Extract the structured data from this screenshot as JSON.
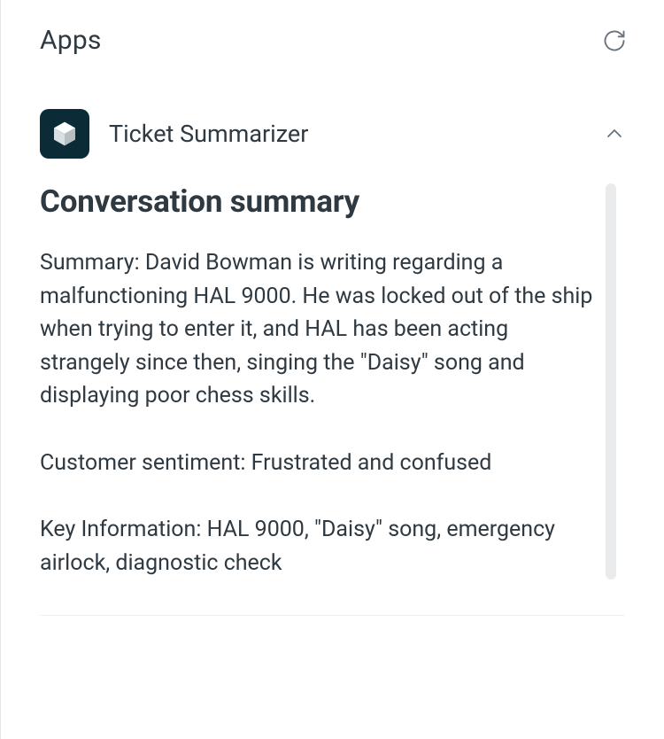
{
  "header": {
    "title": "Apps"
  },
  "app": {
    "name": "Ticket Summarizer",
    "icon_name": "cube-icon",
    "expanded": true
  },
  "summary": {
    "heading": "Conversation summary",
    "summary_text": "Summary: David Bowman is writing regarding a malfunctioning HAL 9000. He was locked out of the ship when trying to enter it, and HAL has been acting strangely since then, singing the \"Daisy\" song and displaying poor chess skills.",
    "sentiment_text": "Customer sentiment: Frustrated and confused",
    "key_info_text": "Key Information: HAL 9000, \"Daisy\" song, emergency airlock, diagnostic check"
  }
}
